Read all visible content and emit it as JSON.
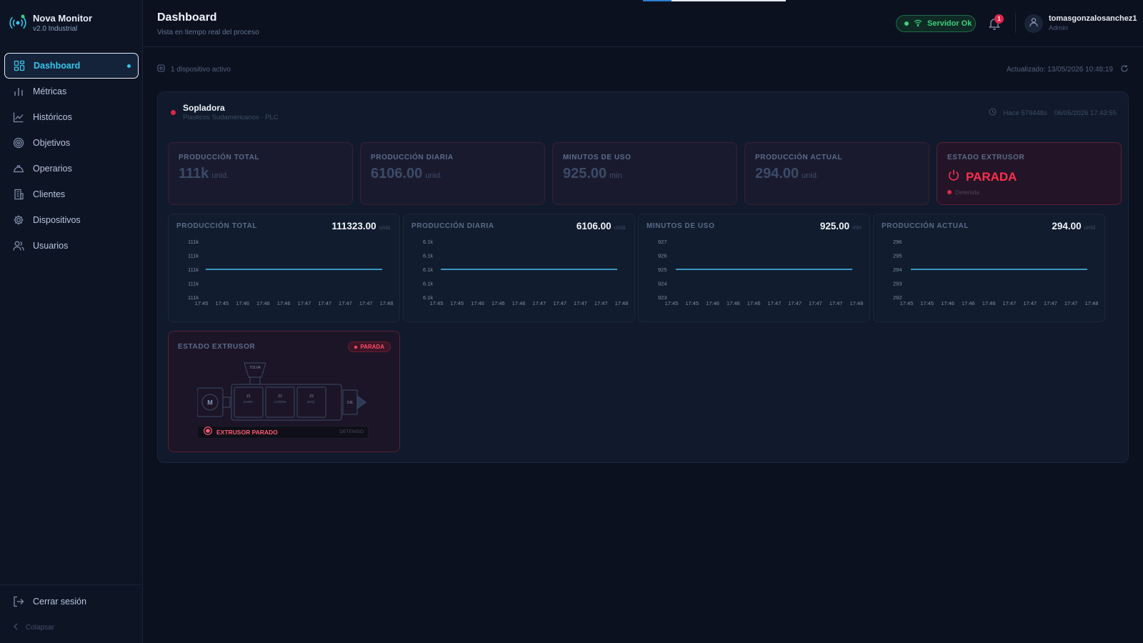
{
  "brand": {
    "name": "Nova Monitor",
    "version": "v2.0 Industrial"
  },
  "sidebar": {
    "items": [
      {
        "label": "Dashboard",
        "icon": "dashboard-icon",
        "active": true
      },
      {
        "label": "Métricas",
        "icon": "bar-chart-icon"
      },
      {
        "label": "Históricos",
        "icon": "line-chart-icon"
      },
      {
        "label": "Objetivos",
        "icon": "target-icon"
      },
      {
        "label": "Operarios",
        "icon": "hard-hat-icon"
      },
      {
        "label": "Clientes",
        "icon": "building-icon"
      },
      {
        "label": "Dispositivos",
        "icon": "gear-icon"
      },
      {
        "label": "Usuarios",
        "icon": "users-icon"
      }
    ],
    "logout_label": "Cerrar sesión",
    "collapse_label": "Colapsar"
  },
  "header": {
    "title": "Dashboard",
    "subtitle": "Vista en tiempo real del proceso",
    "server_status": "Servidor Ok",
    "notification_count": "1",
    "user_name": "tomasgonzalosanchez1",
    "user_role": "Admin",
    "loading_progress": 0.2
  },
  "status": {
    "active_devices": "1 dispositivo activo",
    "updated": "Actualizado: 13/05/2026 10:48:19"
  },
  "device": {
    "name": "Sopladora",
    "subtitle": "Plasticos Sudamericanos · PLC",
    "ago": "Hace 579448s",
    "timestamp": "06/05/2026 17:43:55"
  },
  "kpis": [
    {
      "label": "PRODUCCIÓN TOTAL",
      "value": "111k",
      "unit": "unid."
    },
    {
      "label": "PRODUCCIÓN DIARIA",
      "value": "6106.00",
      "unit": "unid."
    },
    {
      "label": "MINUTOS DE USO",
      "value": "925.00",
      "unit": "min"
    },
    {
      "label": "PRODUCCIÓN ACTUAL",
      "value": "294.00",
      "unit": "unid."
    }
  ],
  "estado": {
    "label": "ESTADO EXTRUSOR",
    "value": "PARADA",
    "sub": "Detenida"
  },
  "charts": [
    {
      "label": "PRODUCCIÓN TOTAL",
      "value": "111323.00",
      "unit": "unid."
    },
    {
      "label": "PRODUCCIÓN DIARIA",
      "value": "6106.00",
      "unit": "unid."
    },
    {
      "label": "MINUTOS DE USO",
      "value": "925.00",
      "unit": "min"
    },
    {
      "label": "PRODUCCIÓN ACTUAL",
      "value": "294.00",
      "unit": "unid."
    }
  ],
  "chart_data": [
    {
      "type": "line",
      "x": [
        "17:45",
        "17:45",
        "17:46",
        "17:46",
        "17:46",
        "17:47",
        "17:47",
        "17:47",
        "17:47",
        "17:48"
      ],
      "series": [
        {
          "values": [
            111323,
            111323,
            111323,
            111323,
            111323,
            111323,
            111323,
            111323,
            111323,
            111323
          ]
        }
      ],
      "ytick_labels": [
        "111k",
        "111k",
        "111k",
        "111k",
        "111k"
      ],
      "ylim": [
        111321,
        111325
      ]
    },
    {
      "type": "line",
      "x": [
        "17:45",
        "17:45",
        "17:46",
        "17:46",
        "17:46",
        "17:47",
        "17:47",
        "17:47",
        "17:47",
        "17:48"
      ],
      "series": [
        {
          "values": [
            6106,
            6106,
            6106,
            6106,
            6106,
            6106,
            6106,
            6106,
            6106,
            6106
          ]
        }
      ],
      "ytick_labels": [
        "6.1k",
        "6.1k",
        "6.1k",
        "6.1k",
        "6.1k"
      ],
      "ylim": [
        6104,
        6108
      ]
    },
    {
      "type": "line",
      "x": [
        "17:45",
        "17:45",
        "17:46",
        "17:46",
        "17:46",
        "17:47",
        "17:47",
        "17:47",
        "17:47",
        "17:48"
      ],
      "series": [
        {
          "values": [
            925,
            925,
            925,
            925,
            925,
            925,
            925,
            925,
            925,
            925
          ]
        }
      ],
      "ytick_labels": [
        "927",
        "926",
        "925",
        "924",
        "923"
      ],
      "ylim": [
        923,
        927
      ]
    },
    {
      "type": "line",
      "x": [
        "17:45",
        "17:45",
        "17:46",
        "17:46",
        "17:46",
        "17:47",
        "17:47",
        "17:47",
        "17:47",
        "17:48"
      ],
      "series": [
        {
          "values": [
            294,
            294,
            294,
            294,
            294,
            294,
            294,
            294,
            294,
            294
          ]
        }
      ],
      "ytick_labels": [
        "296",
        "295",
        "294",
        "293",
        "292"
      ],
      "ylim": [
        292,
        296
      ]
    }
  ],
  "extruder": {
    "label": "ESTADO EXTRUSOR",
    "badge": "PARADA",
    "motor": "M",
    "hopper": "TOLVA",
    "zones": [
      {
        "id": "Z1",
        "name": "BARR."
      },
      {
        "id": "Z2",
        "name": "CAÑÓN"
      },
      {
        "id": "Z3",
        "name": "BOQ."
      }
    ],
    "die": "DIE",
    "status_text": "EXTRUSOR PARADO",
    "status_right": "DETENIDO"
  },
  "colors": {
    "accent": "#37c6ec",
    "danger": "#e0264b",
    "ok": "#3ad07e",
    "line": "#3fa9d6"
  }
}
